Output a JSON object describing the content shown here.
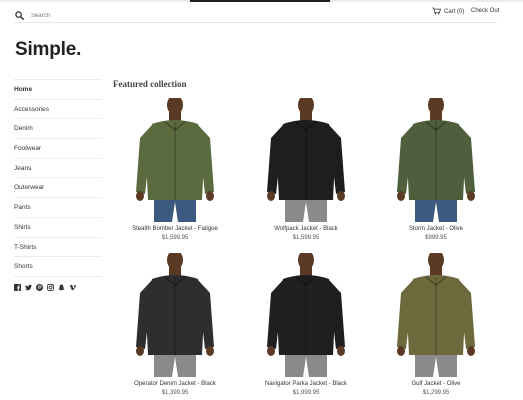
{
  "header": {
    "search_placeholder": "Search",
    "cart_label": "Cart (0)",
    "checkout_label": "Check Out"
  },
  "logo": "Simple.",
  "sidebar": {
    "items": [
      {
        "label": "Home",
        "active": true
      },
      {
        "label": "Accessories"
      },
      {
        "label": "Denim"
      },
      {
        "label": "Footwear"
      },
      {
        "label": "Jeans"
      },
      {
        "label": "Outerwear"
      },
      {
        "label": "Pants"
      },
      {
        "label": "Shirts"
      },
      {
        "label": "T-Shirts"
      },
      {
        "label": "Shorts"
      }
    ],
    "social_icons": [
      "facebook-icon",
      "twitter-icon",
      "pinterest-icon",
      "instagram-icon",
      "snapchat-icon",
      "vimeo-icon"
    ]
  },
  "collection": {
    "title": "Featured collection",
    "products": [
      {
        "name": "Stealth Bomber Jacket - Fatigue",
        "price": "$1,599.95",
        "jacket_color": "#5b6a3f"
      },
      {
        "name": "Wolfpack Jacket - Black",
        "price": "$1,599.95",
        "jacket_color": "#1e1e1e"
      },
      {
        "name": "Storm Jacket - Olive",
        "price": "$999.95",
        "jacket_color": "#4f5e3c"
      },
      {
        "name": "Operator Denim Jacket - Black",
        "price": "$1,399.95",
        "jacket_color": "#2e2e30"
      },
      {
        "name": "Navigator Parka Jacket - Black",
        "price": "$1,999.95",
        "jacket_color": "#1f1f1f"
      },
      {
        "name": "Gulf Jacket - Olive",
        "price": "$1,299.95",
        "jacket_color": "#6c6a3c"
      }
    ]
  },
  "colors": {
    "skin": "#5a3a24",
    "pants_blue": "#3c5a80",
    "pants_grey": "#8a8a8a",
    "text": "#333333",
    "rule": "#ececec"
  }
}
